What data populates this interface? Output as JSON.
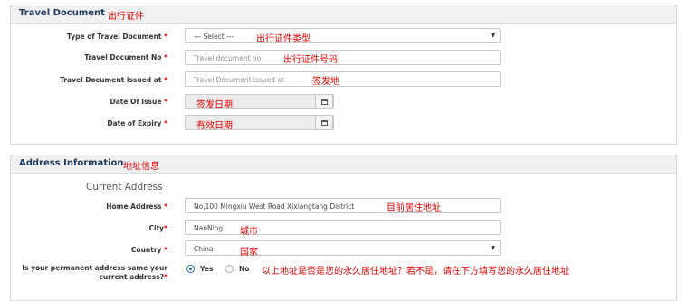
{
  "travel_document": {
    "title": "Travel Document",
    "title_note": "出行证件",
    "fields": {
      "type": {
        "label": "Type of Travel Document",
        "value": "--- Select ---",
        "note": "出行证件类型"
      },
      "number": {
        "label": "Travel Document No",
        "placeholder": "Travel document no",
        "note": "出行证件号码"
      },
      "issued_at": {
        "label": "Travel Document issued at",
        "placeholder": "Travel Document issued at",
        "note": "签发地"
      },
      "date_of_issue": {
        "label": "Date Of Issue",
        "note": "签发日期"
      },
      "date_of_expiry": {
        "label": "Date of Expiry",
        "note": "有效日期"
      }
    }
  },
  "address": {
    "title": "Address Information",
    "title_note": "地址信息",
    "subheading": "Current Address",
    "fields": {
      "home": {
        "label": "Home Address",
        "value": "No,100 Mingxiu West Road Xixiangtang District",
        "note": "目前居住地址"
      },
      "city": {
        "label": "City",
        "value": "NanNing",
        "note": "城市"
      },
      "country": {
        "label": "Country",
        "value": "China",
        "note": "国家"
      },
      "permanent": {
        "label_line1": "Is your permanent address same your",
        "label_line2": "current address?",
        "yes": "Yes",
        "no": "No",
        "selected": "Yes",
        "note": "以上地址是否是您的永久居住地址？若不是，请在下方填写您的永久居住地址"
      }
    }
  },
  "required_mark": "*",
  "colors": {
    "title": "#1d3a5e",
    "annotation": "#e00000",
    "required": "#d00000"
  }
}
